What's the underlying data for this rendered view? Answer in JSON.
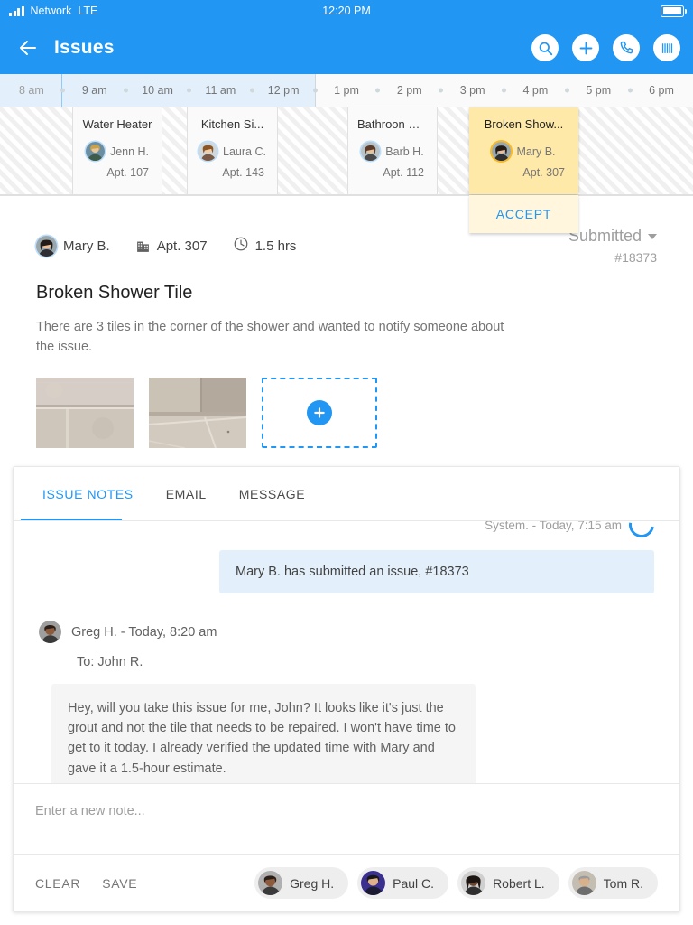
{
  "statusbar": {
    "network": "Network",
    "carrier_type": "LTE",
    "time": "12:20 PM"
  },
  "appbar": {
    "title": "Issues",
    "back_icon": "arrow-left-icon",
    "actions": [
      {
        "name": "search-icon",
        "label": "Search"
      },
      {
        "name": "add-icon",
        "label": "Add"
      },
      {
        "name": "phone-icon",
        "label": "Call"
      },
      {
        "name": "barcode-icon",
        "label": "Scan"
      }
    ]
  },
  "timeline": {
    "ticks": [
      "8 am",
      "9 am",
      "10 am",
      "11 am",
      "12 pm",
      "1 pm",
      "2 pm",
      "3 pm",
      "4 pm",
      "5 pm",
      "6 pm"
    ],
    "events": [
      {
        "title": "Water Heater",
        "person": "Jenn H.",
        "apt": "Apt. 107",
        "selected": false
      },
      {
        "title": "Kitchen Si...",
        "person": "Laura C.",
        "apt": "Apt. 143",
        "selected": false
      },
      {
        "title": "Bathroon Wi...",
        "person": "Barb H.",
        "apt": "Apt. 112",
        "selected": false
      },
      {
        "title": "Broken Show...",
        "person": "Mary B.",
        "apt": "Apt. 307",
        "selected": true,
        "action": "ACCEPT"
      }
    ]
  },
  "issue": {
    "reporter": "Mary B.",
    "unit": "Apt. 307",
    "duration": "1.5 hrs",
    "status": "Submitted",
    "number": "#18373",
    "title": "Broken Shower Tile",
    "description": "There are 3 tiles in the corner of the shower and wanted to notify someone about the issue.",
    "photos": [
      "shower-tile-photo-1",
      "shower-tile-photo-2"
    ],
    "add_photo_icon": "plus-icon"
  },
  "notes": {
    "tabs": [
      {
        "label": "ISSUE NOTES",
        "active": true
      },
      {
        "label": "EMAIL",
        "active": false
      },
      {
        "label": "MESSAGE",
        "active": false
      }
    ],
    "system_entry": {
      "meta": "System. - Today, 7:15 am",
      "text": "Mary B. has submitted an issue, #18373"
    },
    "entries": [
      {
        "meta": "Greg H. - Today, 8:20 am",
        "to": "To: John R.",
        "text": "Hey, will you take this issue for me, John? It looks like it's just the grout and not the tile that needs to be repaired. I won't have time to get to it today. I already verified the updated time with Mary and gave it a 1.5-hour estimate."
      }
    ],
    "composer_placeholder": "Enter a new note...",
    "clear_label": "CLEAR",
    "save_label": "SAVE",
    "assignees": [
      {
        "name": "Greg H."
      },
      {
        "name": "Paul C."
      },
      {
        "name": "Robert L."
      },
      {
        "name": "Tom R."
      }
    ]
  },
  "colors": {
    "brand_blue": "#2196f3",
    "selected_yellow": "#ffe9a8",
    "accept_yellow": "#fff6dd",
    "system_bubble": "#e3f0fb",
    "note_bubble": "#f5f5f5"
  }
}
